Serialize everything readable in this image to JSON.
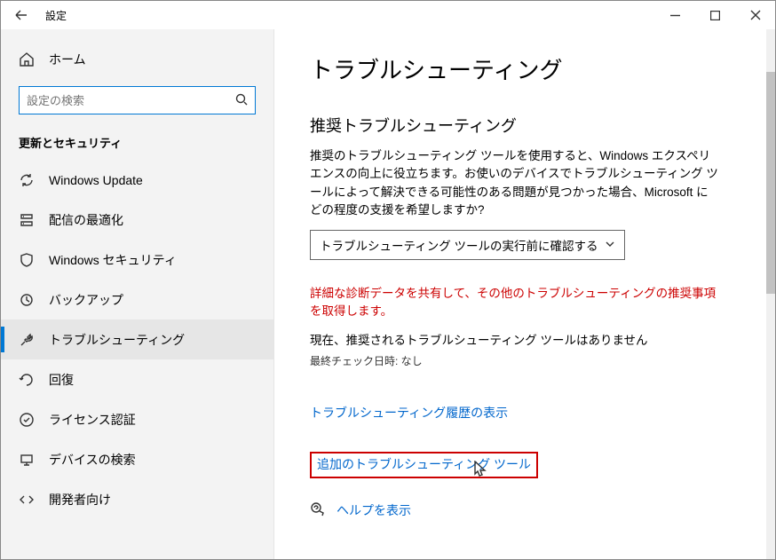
{
  "window": {
    "title": "設定"
  },
  "sidebar": {
    "home": "ホーム",
    "search_placeholder": "設定の検索",
    "section": "更新とセキュリティ",
    "items": [
      {
        "label": "Windows Update"
      },
      {
        "label": "配信の最適化"
      },
      {
        "label": "Windows セキュリティ"
      },
      {
        "label": "バックアップ"
      },
      {
        "label": "トラブルシューティング"
      },
      {
        "label": "回復"
      },
      {
        "label": "ライセンス認証"
      },
      {
        "label": "デバイスの検索"
      },
      {
        "label": "開発者向け"
      }
    ]
  },
  "main": {
    "heading": "トラブルシューティング",
    "section1": "推奨トラブルシューティング",
    "intro": "推奨のトラブルシューティング ツールを使用すると、Windows エクスペリエンスの向上に役立ちます。お使いのデバイスでトラブルシューティング ツールによって解決できる可能性のある問題が見つかった場合、Microsoft にどの程度の支援を希望しますか?",
    "dropdown_value": "トラブルシューティング ツールの実行前に確認する",
    "msg_red": "詳細な診断データを共有して、その他のトラブルシューティングの推奨事項を取得します。",
    "no_rec": "現在、推奨されるトラブルシューティング ツールはありません",
    "last_check": "最終チェック日時: なし",
    "history_link": "トラブルシューティング履歴の表示",
    "additional_link": "追加のトラブルシューティング ツール",
    "help_link": "ヘルプを表示"
  }
}
